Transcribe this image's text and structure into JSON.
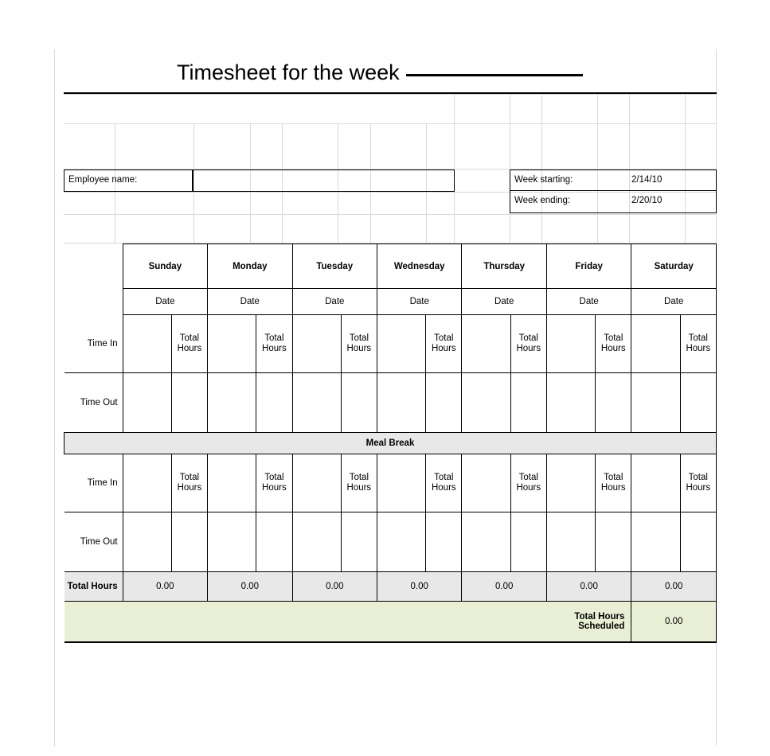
{
  "document": {
    "title_text": "Timesheet for the week",
    "title_blank": ""
  },
  "employee": {
    "label": "Employee name:",
    "value": ""
  },
  "week": {
    "starting_label": "Week starting:",
    "starting_value": "2/14/10",
    "ending_label": "Week ending:",
    "ending_value": "2/20/10"
  },
  "table": {
    "days": [
      {
        "name": "Sunday",
        "date_label": "Date",
        "date_value": "",
        "hours_label": "Total Hours",
        "total": "0.00"
      },
      {
        "name": "Monday",
        "date_label": "Date",
        "date_value": "",
        "hours_label": "Total Hours",
        "total": "0.00"
      },
      {
        "name": "Tuesday",
        "date_label": "Date",
        "date_value": "",
        "hours_label": "Total Hours",
        "total": "0.00"
      },
      {
        "name": "Wednesday",
        "date_label": "Date",
        "date_value": "",
        "hours_label": "Total Hours",
        "total": "0.00"
      },
      {
        "name": "Thursday",
        "date_label": "Date",
        "date_value": "",
        "hours_label": "Total Hours",
        "total": "0.00"
      },
      {
        "name": "Friday",
        "date_label": "Date",
        "date_value": "",
        "hours_label": "Total Hours",
        "total": "0.00"
      },
      {
        "name": "Saturday",
        "date_label": "Date",
        "date_value": "",
        "hours_label": "Total Hours",
        "total": "0.00"
      }
    ],
    "row_labels": {
      "time_in_1": "Time In",
      "time_out_1": "Time Out",
      "meal_break": "Meal Break",
      "time_in_2": "Time In",
      "time_out_2": "Time Out",
      "total_hours": "Total Hours",
      "total_scheduled": "Total Hours Scheduled"
    },
    "total_scheduled_value": "0.00"
  },
  "colors": {
    "header_green": "#E9EFD4",
    "date_cream": "#FAF8EF",
    "hours_gray": "#E8E8E8",
    "border_black": "#000000"
  }
}
